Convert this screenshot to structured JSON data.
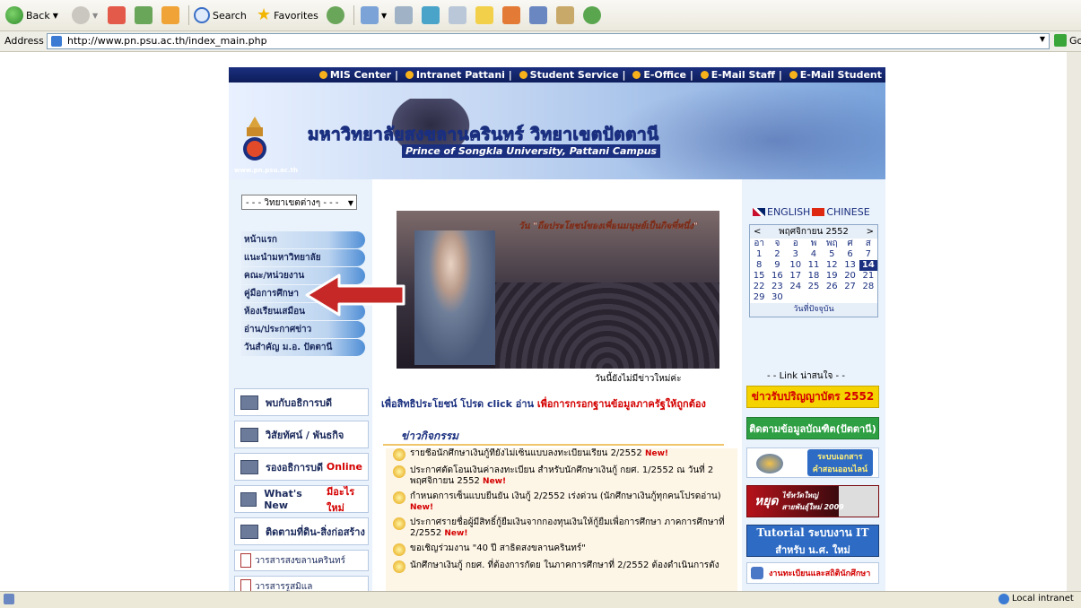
{
  "toolbar": {
    "back": "Back",
    "search": "Search",
    "favorites": "Favorites"
  },
  "address": {
    "label": "Address",
    "url": "http://www.pn.psu.ac.th/index_main.php",
    "go": "Go"
  },
  "topnav": [
    "MIS Center",
    "Intranet Pattani",
    "Student Service",
    "E-Office",
    "E-Mail Staff",
    "E-Mail Student"
  ],
  "banner": {
    "title_th": "มหาวิทยาลัยสงขลานครินทร์ วิทยาเขตปัตตานี",
    "title_en": "Prince of Songkla University, Pattani Campus",
    "url": "www.pn.psu.ac.th"
  },
  "campus_select": "- - - วิทยาเขตต่างๆ - - -",
  "menu": [
    "หน้าแรก",
    "แนะนำมหาวิทยาลัย",
    "คณะ/หน่วยงาน",
    "คู่มือการศึกษา",
    "ห้องเรียนเสมือน",
    "อ่าน/ประกาศข่าว",
    "วันสำคัญ ม.อ. ปัตตานี"
  ],
  "boxes": {
    "b1": "พบกับอธิการบดี",
    "b2": "วิสัยทัศน์ / พันธกิจ",
    "b3a": "รองอธิการบดี",
    "b3b": "Online",
    "b4a": "What's New",
    "b4b": "มีอะไรใหม่",
    "b5": "ติดตามที่ดิน-สิ่งก่อสร้าง",
    "b6": "วารสารสงขลานครินทร์",
    "b7": "วารสารรูสมิแล"
  },
  "photo_caption": "วัน \"ถือประโยชน์ของเพื่อนมนุษย์เป็นกิจที่หนึ่ง\"",
  "no_news": "วันนี้ยังไม่มีข่าวใหม่ค่ะ",
  "notice": {
    "a": "เพื่อสิทธิประโยชน์ โปรด click อ่าน",
    "b": "เพื่อการกรอกฐานข้อมูลภาครัฐให้ถูกต้อง"
  },
  "activities_title": "ข่าวกิจกรรม",
  "new_tag": "New!",
  "activities": [
    "รายชื่อนักศึกษาเงินกู้ที่ยังไม่เซ็นแบบลงทะเบียนเรียน 2/2552",
    "ประกาศตัดโอนเงินค่าลงทะเบียน สำหรับนักศึกษาเงินกู้ กยศ. 1/2552 ณ วันที่ 2 พฤศจิกายน 2552",
    "กำหนดการเซ็นแบบยืนยัน เงินกู้ 2/2552 เร่งด่วน (นักศึกษาเงินกู้ทุกคนโปรดอ่าน)",
    "ประกาศรายชื่อผู้มีสิทธิ์กู้ยืมเงินจากกองทุนเงินให้กู้ยืมเพื่อการศึกษา ภาคการศึกษาที่ 2/2552",
    "ขอเชิญร่วมงาน \"40 ปี สาธิตสงขลานครินทร์\"",
    "นักศึกษาเงินกู้ กยศ. ที่ต้องการกัดย ในภาคการศึกษาที่ 2/2552 ต้องดำเนินการตัง"
  ],
  "lang": {
    "en": "ENGLISH",
    "cn": "CHINESE"
  },
  "calendar": {
    "month": "พฤศจิกายน 2552",
    "dows": [
      "อา",
      "จ",
      "อ",
      "พ",
      "พฤ",
      "ศ",
      "ส"
    ],
    "days": [
      "1",
      "2",
      "3",
      "4",
      "5",
      "6",
      "7",
      "8",
      "9",
      "10",
      "11",
      "12",
      "13",
      "14",
      "15",
      "16",
      "17",
      "18",
      "19",
      "20",
      "21",
      "22",
      "23",
      "24",
      "25",
      "26",
      "27",
      "28",
      "29",
      "30"
    ],
    "today": "วันที่ปัจจุบัน"
  },
  "links_heading": "- - Link น่าสนใจ - -",
  "links": {
    "l1": "ข่าวรับปริญญาบัตร 2552",
    "l2": "ติดตามข้อมูลบัณฑิต(ปัตตานี)",
    "l3a": "ระบบเอกสาร",
    "l3b": "คำสอนออนไลน์",
    "l4a": "หยุด",
    "l4b": "ไข้หวัดใหญ่",
    "l4c": "สายพันธุ์ใหม่ 2009",
    "l5a": "Tutorial ระบบงาน IT",
    "l5b": "สำหรับ น.ศ. ใหม่",
    "l6": "งานทะเบียนและสถิตินักศึกษา"
  },
  "status": {
    "zone": "Local intranet"
  },
  "colors": {
    "nav": "#1a2f7f",
    "accent": "#d40000",
    "link_yellow": "#f5d300",
    "link_green": "#2ea043"
  }
}
